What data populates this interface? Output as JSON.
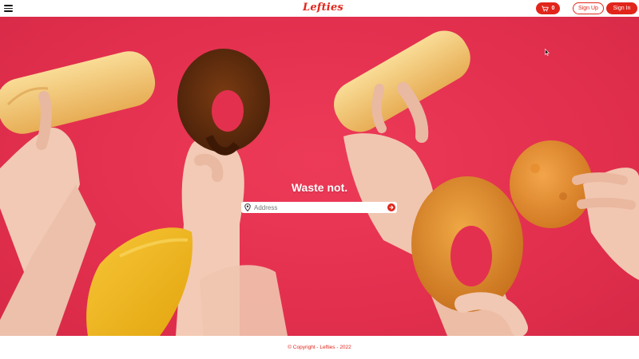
{
  "header": {
    "logo": "Lefties",
    "cart_count": "0",
    "signup_label": "Sign Up",
    "signin_label": "Sign In",
    "menu_icon": "hamburger-icon",
    "cart_icon": "cart-icon"
  },
  "hero": {
    "tagline": "Waste not.",
    "address": {
      "placeholder": "Address",
      "value": "",
      "left_icon": "map-pin-icon",
      "submit_icon": "arrow-right-circle-icon"
    }
  },
  "footer": {
    "copyright": "© Copyright - Lefties - 2022"
  },
  "colors": {
    "brand": "#e1251b",
    "hero_background": "#e4304f"
  }
}
